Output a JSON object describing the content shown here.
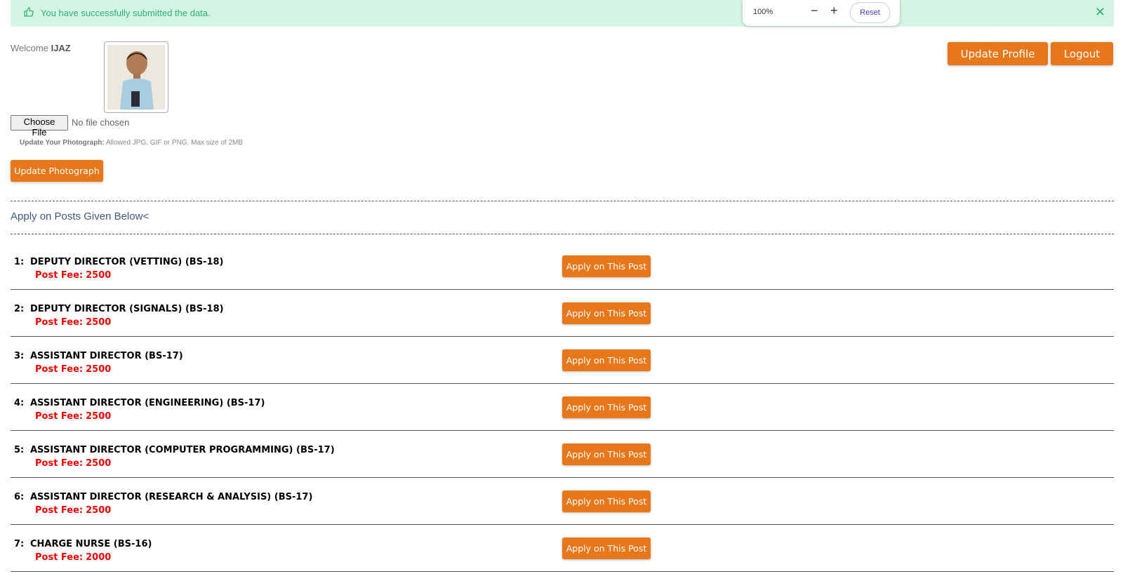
{
  "alert": {
    "icon": "thumbs-up-icon",
    "message": "You have successfully submitted the data.",
    "close_icon": "close-icon",
    "color": "#2db36b",
    "background": "#d4f5e6"
  },
  "zoom_toolbar": {
    "level": "100%",
    "minus": "−",
    "plus": "+",
    "reset_label": "Reset"
  },
  "header": {
    "welcome_prefix": "Welcome",
    "username": "IJAZ",
    "update_profile_label": "Update Profile",
    "logout_label": "Logout"
  },
  "photo_upload": {
    "choose_file_label": "Choose File",
    "no_file_text": "No file chosen",
    "hint_label": "Update Your Photograph:",
    "hint_text": "Allowed JPG, GIF or PNG. Max size of 2MB",
    "update_button_label": "Update Photograph"
  },
  "section_title": "Apply on Posts Given Below<",
  "fee_label": "Post Fee:",
  "apply_label": "Apply on This Post",
  "posts": [
    {
      "num": "1:",
      "title": "DEPUTY DIRECTOR (VETTING) (BS-18)",
      "fee": "2500"
    },
    {
      "num": "2:",
      "title": "DEPUTY DIRECTOR (SIGNALS) (BS-18)",
      "fee": "2500"
    },
    {
      "num": "3:",
      "title": "ASSISTANT DIRECTOR (BS-17)",
      "fee": "2500"
    },
    {
      "num": "4:",
      "title": "ASSISTANT DIRECTOR (ENGINEERING) (BS-17)",
      "fee": "2500"
    },
    {
      "num": "5:",
      "title": "ASSISTANT DIRECTOR (COMPUTER PROGRAMMING) (BS-17)",
      "fee": "2500"
    },
    {
      "num": "6:",
      "title": "ASSISTANT DIRECTOR (RESEARCH & ANALYSIS) (BS-17)",
      "fee": "2500"
    },
    {
      "num": "7:",
      "title": "CHARGE NURSE (BS-16)",
      "fee": "2000"
    }
  ],
  "colors": {
    "accent": "#e8771a",
    "fee": "#f00000",
    "section_title": "#3d5a80"
  }
}
